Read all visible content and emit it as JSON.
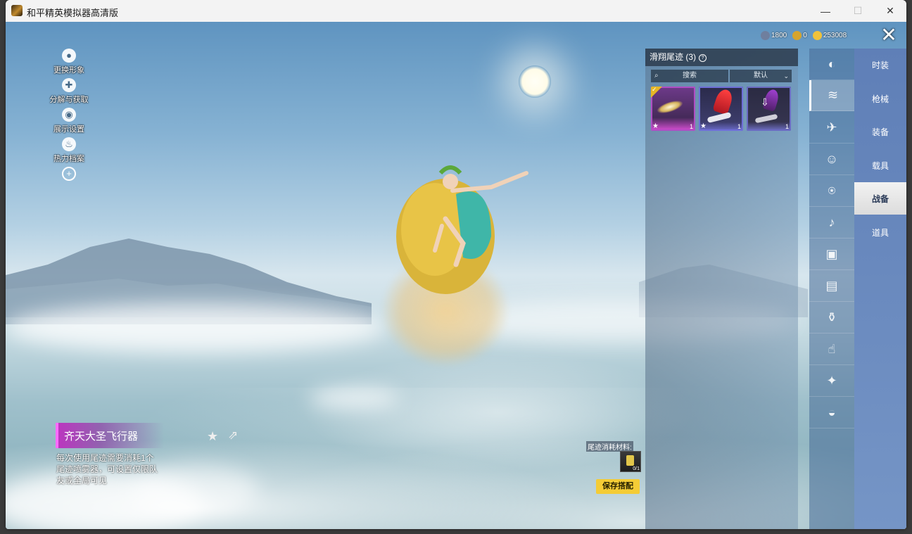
{
  "window": {
    "title": "和平精英模拟器高清版",
    "controls": [
      "minimize-icon",
      "maximize-icon",
      "close-icon"
    ]
  },
  "currency": [
    {
      "icon": "gem-icon",
      "value": "1800",
      "color": "#6f7f9e"
    },
    {
      "icon": "coin-icon",
      "value": "0",
      "color": "#d6a42c"
    },
    {
      "icon": "star-coin-icon",
      "value": "253008",
      "color": "#f0c23a"
    }
  ],
  "left_tools": [
    {
      "icon": "avatar-icon",
      "label": "更换形象"
    },
    {
      "icon": "puzzle-icon",
      "label": "分解与获取"
    },
    {
      "icon": "eye-icon",
      "label": "展示设置"
    },
    {
      "icon": "fire-icon",
      "label": "热力档案"
    },
    {
      "icon": "zoom-in-icon",
      "label": ""
    }
  ],
  "panel": {
    "title": "滑翔尾迹 (3)",
    "help_icon": "question-icon",
    "search_placeholder": "搜索",
    "sort_value": "默认",
    "items": [
      {
        "name": "trail-card-1",
        "selected": true,
        "count": "1"
      },
      {
        "name": "trail-card-2",
        "selected": false,
        "count": "1"
      },
      {
        "name": "trail-card-3",
        "selected": false,
        "count": "1"
      }
    ]
  },
  "category_icons": [
    "pan-icon",
    "glider-trail-icon",
    "plane-icon",
    "emoji-icon",
    "robot-icon",
    "speaker-icon",
    "robot-face-icon",
    "photo-icon",
    "grenade-icon",
    "hand-icon",
    "magic-wand-icon",
    "roast-chicken-icon"
  ],
  "category_active_index": 1,
  "tabs": [
    "时装",
    "枪械",
    "装备",
    "载具",
    "战备",
    "道具"
  ],
  "tabs_active_index": 4,
  "item": {
    "name": "齐天大圣飞行器",
    "description": "每次使用尾迹需要消耗1个尾迹喷雾器，可设置仅限队友或全局可见",
    "material_label": "尾迹消耗材料:",
    "material_count": "0/1"
  },
  "buttons": {
    "save": "保存搭配",
    "close": "✕"
  }
}
